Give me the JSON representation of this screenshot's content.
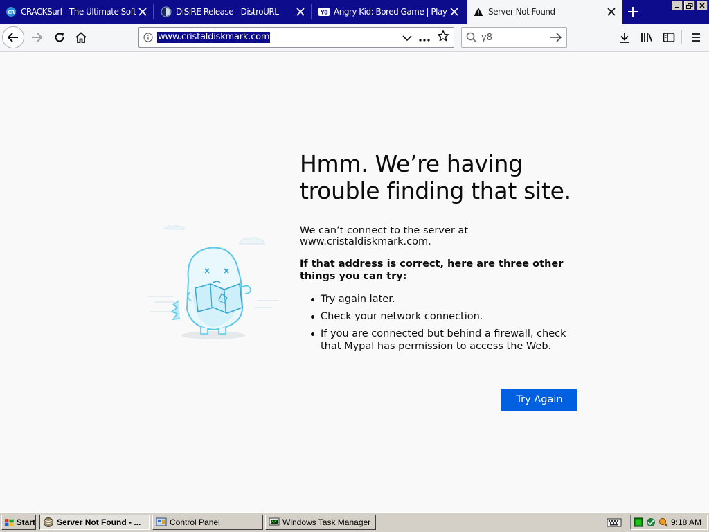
{
  "tabs": [
    {
      "title": "CRACKSurl - The Ultimate Softwar",
      "favicon": "crack-favicon",
      "active": false
    },
    {
      "title": "DiSiRE Release - DistroURL",
      "favicon": "distro-favicon",
      "active": false
    },
    {
      "title": "Angry Kid: Bored Game | Play Now",
      "favicon": "y8-favicon",
      "favicon_text": "Y8",
      "active": false
    },
    {
      "title": "Server Not Found",
      "favicon": "warning-icon",
      "active": true
    }
  ],
  "toolbar": {
    "url": "www.cristaldiskmark.com",
    "search_value": "y8"
  },
  "error_page": {
    "title": "Hmm. We’re having trouble finding that site.",
    "description": "We can’t connect to the server at www.cristaldiskmark.com.",
    "subheading": "If that address is correct, here are three other things you can try:",
    "suggestions": [
      "Try again later.",
      "Check your network connection.",
      "If you are connected but behind a firewall, check that Mypal has permission to access the Web."
    ],
    "try_again_label": "Try Again"
  },
  "taskbar": {
    "start_label": "Start",
    "tasks": [
      {
        "label": "Server Not Found - ...",
        "active": true
      },
      {
        "label": "Control Panel",
        "active": false
      },
      {
        "label": "Windows Task Manager",
        "active": false
      }
    ],
    "clock": "9:18 AM"
  },
  "colors": {
    "tabstrip": "#0c0c8c",
    "button_primary": "#0060df",
    "page_background": "#f9f9fa",
    "taskbar": "#d4d0c8",
    "illustration_stroke": "#5cc7e8"
  }
}
